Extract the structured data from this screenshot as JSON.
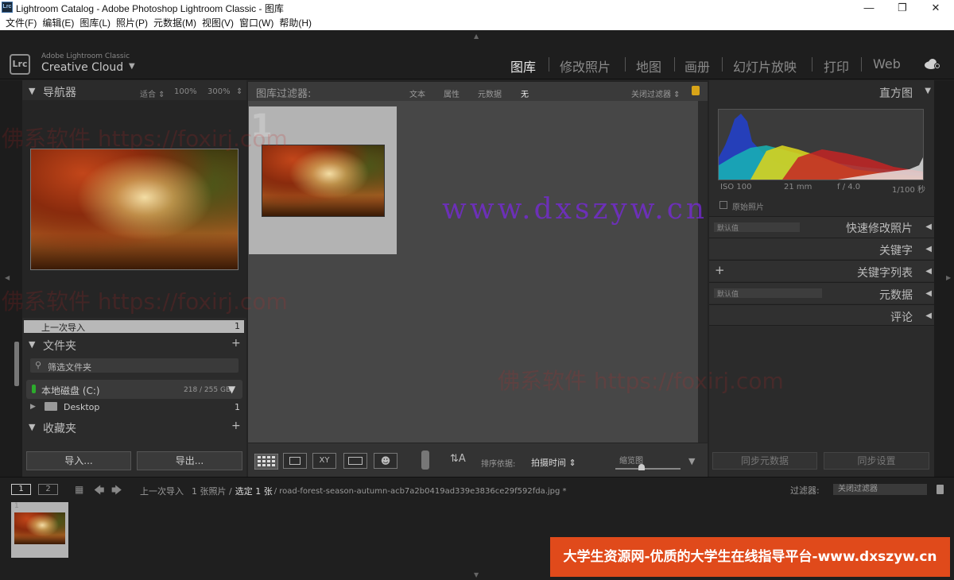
{
  "window": {
    "title": "Lightroom Catalog - Adobe Photoshop Lightroom Classic - 图库",
    "app_icon": "Lrc"
  },
  "menu": [
    "文件(F)",
    "编辑(E)",
    "图库(L)",
    "照片(P)",
    "元数据(M)",
    "视图(V)",
    "窗口(W)",
    "帮助(H)"
  ],
  "identity": {
    "logo": "Lrc",
    "line1": "Adobe Lightroom Classic",
    "line2": "Creative Cloud"
  },
  "modules": [
    "图库",
    "修改照片",
    "地图",
    "画册",
    "幻灯片放映",
    "打印",
    "Web"
  ],
  "active_module": "图库",
  "navigator": {
    "title": "导航器",
    "fit": "适合",
    "z1": "100%",
    "z2": "300%"
  },
  "catalog": {
    "last_import": "上一次导入",
    "last_import_count": "1"
  },
  "folders": {
    "title": "文件夹",
    "filter_placeholder": "筛选文件夹",
    "drive": "本地磁盘 (C:)",
    "drive_size": "218 / 255 GB",
    "folder": "Desktop",
    "folder_count": "1"
  },
  "collections": {
    "title": "收藏夹"
  },
  "left_buttons": {
    "import": "导入...",
    "export": "导出..."
  },
  "filter_bar": {
    "label": "图库过滤器:",
    "text": "文本",
    "attribute": "属性",
    "metadata": "元数据",
    "none": "无",
    "close": "关闭过滤器"
  },
  "histogram": {
    "title": "直方图",
    "iso": "ISO 100",
    "focal": "21 mm",
    "aperture": "f / 4.0",
    "shutter": "1/100 秒",
    "original": "原始照片"
  },
  "right_panels": {
    "quick_develop": "快速修改照片",
    "keywords": "关键字",
    "keyword_list": "关键字列表",
    "metadata": "元数据",
    "comments": "评论",
    "default1": "默认值",
    "default2": "默认值"
  },
  "right_buttons": {
    "sync_meta": "同步元数据",
    "sync_settings": "同步设置"
  },
  "toolbar": {
    "sort_label": "排序依据:",
    "sort_value": "拍摄时间",
    "thumb_label": "缩览图"
  },
  "filmstrip": {
    "screen1": "1",
    "screen2": "2",
    "source": "上一次导入",
    "count": "1 张照片 /",
    "selected": "选定 1 张",
    "filename": "/ road-forest-season-autumn-acb7a2b0419ad339e3836ce29f592fda.jpg *",
    "filter_label": "过滤器:",
    "filter_value": "关闭过滤器",
    "thumb_index": "1"
  },
  "watermarks": {
    "center": "www.dxszyw.cn",
    "foxirj": "佛系软件 https://foxirj.com",
    "banner": "大学生资源网-优质的大学生在线指导平台-www.dxszyw.cn"
  },
  "colors": {
    "accent": "#e04a1b",
    "banner_bg": "#e04a1b"
  }
}
